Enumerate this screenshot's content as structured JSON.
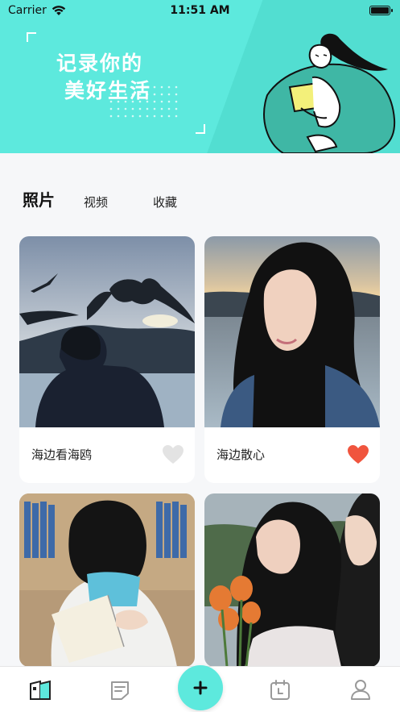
{
  "status_bar": {
    "carrier": "Carrier",
    "time": "11:51 AM"
  },
  "banner": {
    "slogan_line1": "记录你的",
    "slogan_line2": "美好生活"
  },
  "tabs": [
    {
      "label": "照片",
      "active": true
    },
    {
      "label": "视频",
      "active": false
    },
    {
      "label": "收藏",
      "active": false
    }
  ],
  "cards": [
    {
      "caption": "海边看海鸥",
      "liked": false
    },
    {
      "caption": "海边散心",
      "liked": true
    },
    {
      "caption": "",
      "liked": false
    },
    {
      "caption": "",
      "liked": false
    }
  ],
  "colors": {
    "accent": "#5de9dd",
    "liked": "#f0553e",
    "unliked": "#e3e3e3"
  },
  "tab_bar": {
    "items": [
      "home-icon",
      "note-icon",
      "add-icon",
      "calendar-icon",
      "profile-icon"
    ]
  }
}
